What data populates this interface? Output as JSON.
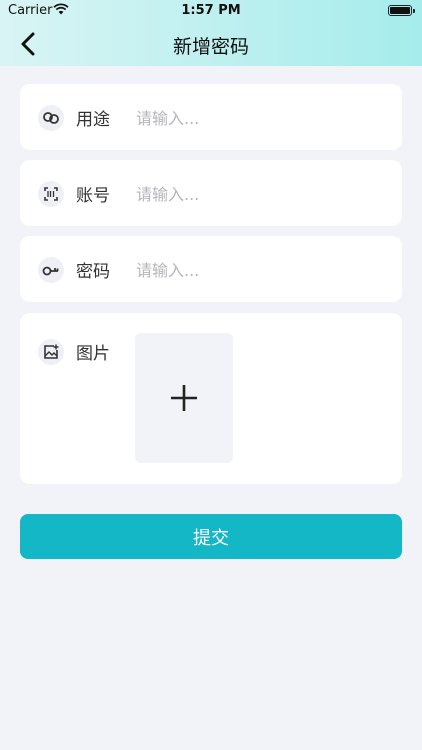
{
  "status_bar": {
    "carrier": "Carrier",
    "time": "1:57 PM"
  },
  "nav": {
    "title": "新增密码",
    "back_icon": "chevron-left-icon"
  },
  "form": {
    "purpose": {
      "label": "用途",
      "placeholder": "请输入...",
      "value": "",
      "icon": "link-icon"
    },
    "account": {
      "label": "账号",
      "placeholder": "请输入...",
      "value": "",
      "icon": "scan-icon"
    },
    "password": {
      "label": "密码",
      "placeholder": "请输入...",
      "value": "",
      "icon": "key-icon"
    },
    "image": {
      "label": "图片",
      "icon": "image-add-icon",
      "add_icon": "plus-icon"
    }
  },
  "submit_label": "提交",
  "colors": {
    "header_start": "#d9f4f4",
    "header_end": "#a6ecec",
    "accent": "#13b7c6",
    "background": "#f2f3f8"
  }
}
